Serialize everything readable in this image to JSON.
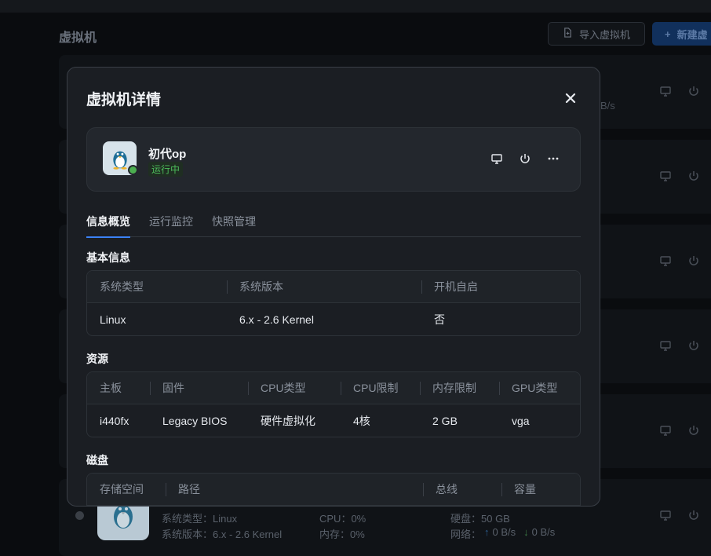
{
  "background": {
    "page_title": "虚拟机",
    "import_button": "导入虚拟机",
    "new_button": "新建虚",
    "speed_fragment": "B/s",
    "bottom_card": {
      "sys_type": "系统类型：Linux",
      "sys_version": "系统版本：6.x - 2.6 Kernel",
      "cpu": "CPU：0%",
      "mem": "内存：0%",
      "disk": "硬盘：50 GB",
      "net_label": "网络：",
      "net_up": "0 B/s",
      "net_down": "0 B/s"
    }
  },
  "modal": {
    "title": "虚拟机详情",
    "vm": {
      "name": "初代op",
      "status": "运行中"
    },
    "tabs": [
      {
        "label": "信息概览",
        "active": true
      },
      {
        "label": "运行监控",
        "active": false
      },
      {
        "label": "快照管理",
        "active": false
      }
    ],
    "basic": {
      "title": "基本信息",
      "headers": [
        "系统类型",
        "系统版本",
        "开机自启"
      ],
      "values": [
        "Linux",
        "6.x - 2.6 Kernel",
        "否"
      ]
    },
    "resources": {
      "title": "资源",
      "headers": [
        "主板",
        "固件",
        "CPU类型",
        "CPU限制",
        "内存限制",
        "GPU类型"
      ],
      "values": [
        "i440fx",
        "Legacy BIOS",
        "硬件虚拟化",
        "4核",
        "2 GB",
        "vga"
      ]
    },
    "disk": {
      "title": "磁盘",
      "headers": [
        "存储空间",
        "路径",
        "总线",
        "容量"
      ]
    }
  },
  "colors": {
    "accent": "#3b82f6",
    "running": "#4cbb5a",
    "modal_bg": "#1b1e23"
  }
}
